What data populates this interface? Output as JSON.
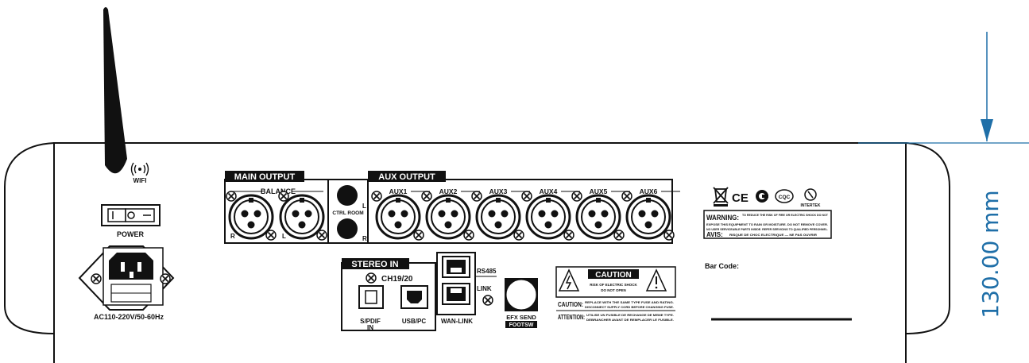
{
  "wifi": {
    "label": "WIFI",
    "icon": "wifi-signal-icon"
  },
  "power": {
    "label": "POWER",
    "symbol_on": "I",
    "symbol_off": "O"
  },
  "ac_input": {
    "label": "AC110-220V/50-60Hz"
  },
  "main_output": {
    "title": "MAIN OUTPUT",
    "balance": "BALANCE",
    "left": "L",
    "right": "R"
  },
  "ctrl_room": {
    "label": "CTRL ROOM",
    "left": "L",
    "right": "R"
  },
  "aux_output": {
    "title": "AUX OUTPUT",
    "channels": [
      "AUX1",
      "AUX2",
      "AUX3",
      "AUX4",
      "AUX5",
      "AUX6"
    ]
  },
  "stereo_in": {
    "title": "STEREO IN",
    "channel": "CH19/20",
    "spdif_line1": "S/PDIF",
    "spdif_line2": "IN",
    "usb": "USB/PC"
  },
  "network": {
    "rs485": "RS485",
    "link": "LINK",
    "wan_link": "WAN-LINK"
  },
  "efx": {
    "label": "EFX SEND",
    "sub": "FOOTSW"
  },
  "caution": {
    "title": "CAUTION",
    "line1": "RISK OF ELECTRIC SHOCK",
    "line2": "DO NOT OPEN",
    "caution_label": "CAUTION:",
    "caution_text1": "REPLACE WITH THE SAME TYPE FUSE AND RATING.",
    "caution_text2": "DISCONNECT SUPPLY CORD BEFORE CHANGING FUSE.",
    "attention_label": "ATTENTION:",
    "attention_text1": "UTILISE UN FUSIBLE DE RECHANGE DE MEME TYPE.",
    "attention_text2": "DEBRANCHER AVANT DE REMPLACER LE FUSIBLE."
  },
  "certs": {
    "ce": "CE",
    "cqc": "CQC",
    "intertek": "INTERTEK"
  },
  "warning": {
    "label": "WARNING:",
    "text1": "TO REDUCE THE RISK OF FIRE OR ELECTRIC SHOCK DO NOT",
    "text2": "EXPOSE THIS EQUIPMENT TO RAIN OR MOISTURE. DO NOT REMOVE COVER.",
    "text3": "NO USER SERVICEABLE PARTS INSIDE. REFER SERVICING TO QUALIFIED PERSONNEL.",
    "avis_label": "AVIS:",
    "avis_text": "RISQUE DE CHOC ELECTRIQUE — NE PAS OUVRIR"
  },
  "barcode": {
    "label": "Bar Code:"
  },
  "dimension": {
    "value": "130.00 mm",
    "color": "#1f6fa8"
  }
}
